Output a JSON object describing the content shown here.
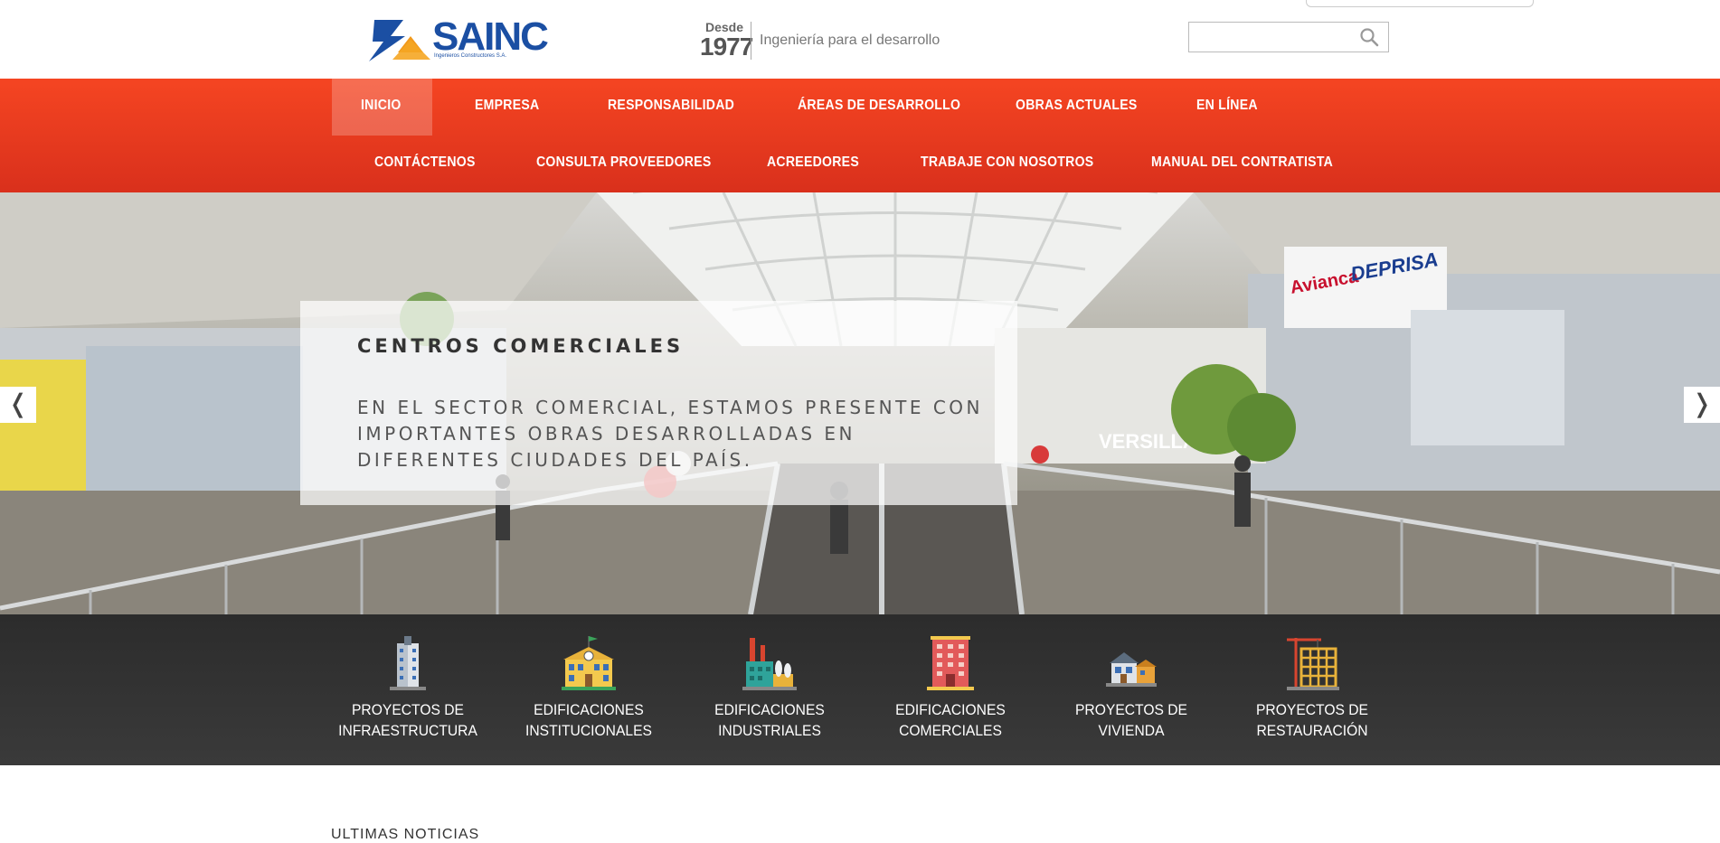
{
  "header": {
    "logo_text": "SAINC",
    "logo_subtitle": "Ingenieros Constructores S.A.",
    "since_word": "Desde",
    "since_year": "1977",
    "tagline": "Ingeniería para el desarrollo",
    "search": {
      "placeholder": "",
      "icon": "search-icon"
    }
  },
  "nav": {
    "row1": [
      "INICIO",
      "EMPRESA",
      "RESPONSABILIDAD",
      "ÁREAS DE DESARROLLO",
      "OBRAS ACTUALES",
      "EN LÍNEA"
    ],
    "row2": [
      "CONTÁCTENOS",
      "CONSULTA PROVEEDORES",
      "ACREEDORES",
      "TRABAJE CON NOSOTROS",
      "MANUAL DEL CONTRATISTA"
    ],
    "active": "INICIO",
    "accent": "#ee3d20"
  },
  "slider": {
    "title": "CENTROS COMERCIALES",
    "text": "EN EL SECTOR COMERCIAL, ESTAMOS PRESENTE CON IMPORTANTES OBRAS DESARROLLADAS EN DIFERENTES CIUDADES DEL PAÍS.",
    "prev": "❬",
    "next": "❭",
    "store_signs": [
      "Avianca",
      "DEPRISA",
      "VERSILLA"
    ]
  },
  "categories": [
    {
      "line1": "PROYECTOS DE",
      "line2": "INFRAESTRUCTURA",
      "icon": "tower-building-icon"
    },
    {
      "line1": "EDIFICACIONES",
      "line2": "INSTITUCIONALES",
      "icon": "school-building-icon"
    },
    {
      "line1": "EDIFICACIONES",
      "line2": "INDUSTRIALES",
      "icon": "factory-icon"
    },
    {
      "line1": "EDIFICACIONES",
      "line2": "COMERCIALES",
      "icon": "commercial-building-icon"
    },
    {
      "line1": "PROYECTOS DE",
      "line2": "VIVIENDA",
      "icon": "house-icon"
    },
    {
      "line1": "PROYECTOS DE",
      "line2": "RESTAURACIÓN",
      "icon": "crane-scaffold-icon"
    }
  ],
  "news_heading": "ULTIMAS NOTICIAS"
}
